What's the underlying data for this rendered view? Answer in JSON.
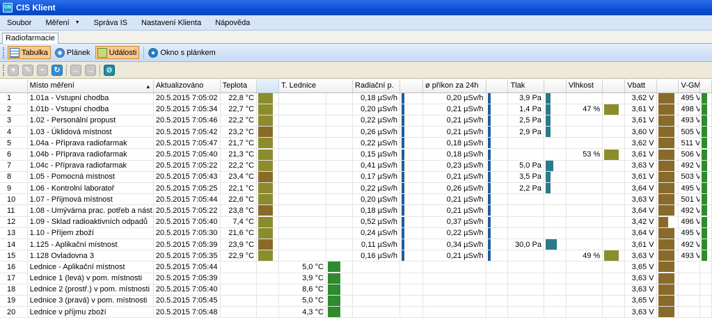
{
  "window": {
    "title": "CIS Klient",
    "logo_text": "CIS"
  },
  "menu": [
    "Soubor",
    "Měření",
    "Správa IS",
    "Nastavení Klienta",
    "Nápověda"
  ],
  "tabs": [
    "Radiofarmacie"
  ],
  "views": {
    "table": "Tabulka",
    "plan": "Plánek",
    "events": "Události",
    "window_with_plan": "Okno s plánkem"
  },
  "toolbar_icons": [
    "add-icon",
    "edit-icon",
    "remove-icon",
    "refresh-icon",
    "back-icon",
    "forward-icon",
    "disable-icon"
  ],
  "columns": {
    "place": "Místo měření",
    "updated": "Aktualizováno",
    "temp": "Teplota",
    "fridge": "T. Lednice",
    "rad": "Radiační p.",
    "dose": "ø příkon za 24h",
    "press": "Tlak",
    "hum": "Vlhkost",
    "vbatt": "Vbatt",
    "vgm": "V-GM"
  },
  "colors": {
    "olive": "#8c8c2c",
    "brown": "#8a6a2a",
    "green": "#2e8b2e",
    "blue": "#1f5c99",
    "teal": "#2a7a8a",
    "header_highlight": "#cfe4f7"
  },
  "rows": [
    {
      "n": "1",
      "place": "1.01a - Vstupní chodba",
      "time": "20.5.2015 7:05:02",
      "temp": "22,8 °C",
      "fridge": "",
      "rad": "0,18 µSv/h",
      "dose": "0,20 µSv/h",
      "press": "3,9 Pa",
      "hum": "",
      "vbatt": "3,62 V",
      "vgm": "495 V"
    },
    {
      "n": "2",
      "place": "1.01b - Vstupní chodba",
      "time": "20.5.2015 7:05:34",
      "temp": "22,7 °C",
      "fridge": "",
      "rad": "0,20 µSv/h",
      "dose": "0,21 µSv/h",
      "press": "1,4 Pa",
      "hum": "47 %",
      "vbatt": "3,61 V",
      "vgm": "498 V"
    },
    {
      "n": "3",
      "place": "1.02 - Personální propust",
      "time": "20.5.2015 7:05:46",
      "temp": "22,2 °C",
      "fridge": "",
      "rad": "0,22 µSv/h",
      "dose": "0,21 µSv/h",
      "press": "2,5 Pa",
      "hum": "",
      "vbatt": "3,61 V",
      "vgm": "493 V"
    },
    {
      "n": "4",
      "place": "1.03 - Úklidová místnost",
      "time": "20.5.2015 7:05:42",
      "temp": "23,2 °C",
      "fridge": "",
      "rad": "0,26 µSv/h",
      "dose": "0,21 µSv/h",
      "press": "2,9 Pa",
      "hum": "",
      "vbatt": "3,60 V",
      "vgm": "505 V"
    },
    {
      "n": "5",
      "place": "1.04a - Příprava radiofarmak",
      "time": "20.5.2015 7:05:47",
      "temp": "21,7 °C",
      "fridge": "",
      "rad": "0,22 µSv/h",
      "dose": "0,18 µSv/h",
      "press": "",
      "hum": "",
      "vbatt": "3,62 V",
      "vgm": "511 V"
    },
    {
      "n": "6",
      "place": "1.04b - Příprava radiofarmak",
      "time": "20.5.2015 7:05:40",
      "temp": "21,3 °C",
      "fridge": "",
      "rad": "0,15 µSv/h",
      "dose": "0,18 µSv/h",
      "press": "",
      "hum": "53 %",
      "vbatt": "3,61 V",
      "vgm": "506 V"
    },
    {
      "n": "7",
      "place": "1.04c - Příprava radiofarmak",
      "time": "20.5.2015 7:05:22",
      "temp": "22,2 °C",
      "fridge": "",
      "rad": "0,41 µSv/h",
      "dose": "0,23 µSv/h",
      "press": "5,0 Pa",
      "hum": "",
      "vbatt": "3,63 V",
      "vgm": "492 V"
    },
    {
      "n": "8",
      "place": "1.05 - Pomocná místnost",
      "time": "20.5.2015 7:05:43",
      "temp": "23,4 °C",
      "fridge": "",
      "rad": "0,17 µSv/h",
      "dose": "0,21 µSv/h",
      "press": "3,5 Pa",
      "hum": "",
      "vbatt": "3,61 V",
      "vgm": "503 V"
    },
    {
      "n": "9",
      "place": "1.06 - Kontrolní laboratoř",
      "time": "20.5.2015 7:05:25",
      "temp": "22,1 °C",
      "fridge": "",
      "rad": "0,22 µSv/h",
      "dose": "0,26 µSv/h",
      "press": "2,2 Pa",
      "hum": "",
      "vbatt": "3,64 V",
      "vgm": "495 V"
    },
    {
      "n": "10",
      "place": "1.07 - Příjmová místnost",
      "time": "20.5.2015 7:05:44",
      "temp": "22,6 °C",
      "fridge": "",
      "rad": "0,20 µSv/h",
      "dose": "0,21 µSv/h",
      "press": "",
      "hum": "",
      "vbatt": "3,63 V",
      "vgm": "501 V"
    },
    {
      "n": "11",
      "place": "1.08 - Umývárna prac. potřeb a nást.",
      "time": "20.5.2015 7:05:22",
      "temp": "23,8 °C",
      "fridge": "",
      "rad": "0,18 µSv/h",
      "dose": "0,21 µSv/h",
      "press": "",
      "hum": "",
      "vbatt": "3,64 V",
      "vgm": "492 V"
    },
    {
      "n": "12",
      "place": "1.09 - Sklad radioaktivních odpadů",
      "time": "20.5.2015 7:05:40",
      "temp": "7,4 °C",
      "fridge": "",
      "rad": "0,52 µSv/h",
      "dose": "0,37 µSv/h",
      "press": "",
      "hum": "",
      "vbatt": "3,42 V",
      "vgm": "496 V"
    },
    {
      "n": "13",
      "place": "1.10 - Příjem zboží",
      "time": "20.5.2015 7:05:30",
      "temp": "21,6 °C",
      "fridge": "",
      "rad": "0,24 µSv/h",
      "dose": "0,22 µSv/h",
      "press": "",
      "hum": "",
      "vbatt": "3,64 V",
      "vgm": "495 V"
    },
    {
      "n": "14",
      "place": "1.125 - Aplikační místnost",
      "time": "20.5.2015 7:05:39",
      "temp": "23,9 °C",
      "fridge": "",
      "rad": "0,11 µSv/h",
      "dose": "0,34 µSv/h",
      "press": "30,0 Pa",
      "hum": "",
      "vbatt": "3,61 V",
      "vgm": "492 V"
    },
    {
      "n": "15",
      "place": "1.128 Ovladovna 3",
      "time": "20.5.2015 7:05:35",
      "temp": "22,9 °C",
      "fridge": "",
      "rad": "0,16 µSv/h",
      "dose": "0,21 µSv/h",
      "press": "",
      "hum": "49 %",
      "vbatt": "3,63 V",
      "vgm": "493 V"
    },
    {
      "n": "16",
      "place": "Lednice - Aplikační místnost",
      "time": "20.5.2015 7:05:44",
      "temp": "",
      "fridge": "5,0 °C",
      "rad": "",
      "dose": "",
      "press": "",
      "hum": "",
      "vbatt": "3,65 V",
      "vgm": ""
    },
    {
      "n": "17",
      "place": "Lednice 1 (levá) v pom. místnosti",
      "time": "20.5.2015 7:05:39",
      "temp": "",
      "fridge": "3,9 °C",
      "rad": "",
      "dose": "",
      "press": "",
      "hum": "",
      "vbatt": "3,63 V",
      "vgm": ""
    },
    {
      "n": "18",
      "place": "Lednice 2 (prostř.) v pom. místnosti",
      "time": "20.5.2015 7:05:40",
      "temp": "",
      "fridge": "8,6 °C",
      "rad": "",
      "dose": "",
      "press": "",
      "hum": "",
      "vbatt": "3,63 V",
      "vgm": ""
    },
    {
      "n": "19",
      "place": "Lednice 3 (pravá) v pom. místnosti",
      "time": "20.5.2015 7:05:45",
      "temp": "",
      "fridge": "5,0 °C",
      "rad": "",
      "dose": "",
      "press": "",
      "hum": "",
      "vbatt": "3,65 V",
      "vgm": ""
    },
    {
      "n": "20",
      "place": "Lednice v příjmu zboží",
      "time": "20.5.2015 7:05:48",
      "temp": "",
      "fridge": "4,3 °C",
      "rad": "",
      "dose": "",
      "press": "",
      "hum": "",
      "vbatt": "3,63 V",
      "vgm": ""
    }
  ]
}
